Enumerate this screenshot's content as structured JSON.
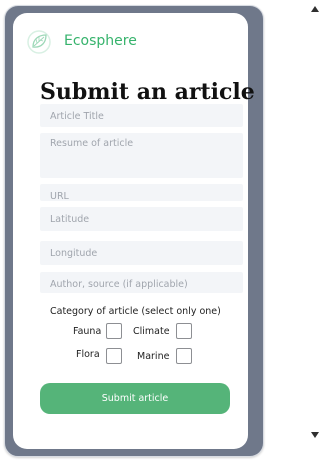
{
  "app": {
    "brand_name": "Ecosphere",
    "brand_icon": "leaf-icon"
  },
  "page": {
    "title": "Submit an article"
  },
  "form": {
    "fields": [
      {
        "name": "article-title",
        "placeholder": "Article Title",
        "value": ""
      },
      {
        "name": "resume",
        "placeholder": "Resume of article",
        "value": ""
      },
      {
        "name": "url",
        "placeholder": "URL",
        "value": ""
      },
      {
        "name": "latitude",
        "placeholder": "Latitude",
        "value": ""
      },
      {
        "name": "longitude",
        "placeholder": "Longitude",
        "value": ""
      },
      {
        "name": "author-source",
        "placeholder": "Author, source (if applicable)",
        "value": ""
      }
    ],
    "category_label": "Category of article (select only one)",
    "categories": [
      {
        "label": "Fauna",
        "checked": false
      },
      {
        "label": "Climate",
        "checked": false
      },
      {
        "label": "Flora",
        "checked": false
      },
      {
        "label": "Marine",
        "checked": false
      }
    ],
    "submit_label": "Submit article"
  },
  "theme": {
    "accent": "#36B36C",
    "button": "#55B479",
    "frame": "#6F788A",
    "field_bg": "#F3F5F8"
  },
  "scrollbar": {
    "up_icon": "triangle-up-icon",
    "down_icon": "triangle-down-icon"
  }
}
